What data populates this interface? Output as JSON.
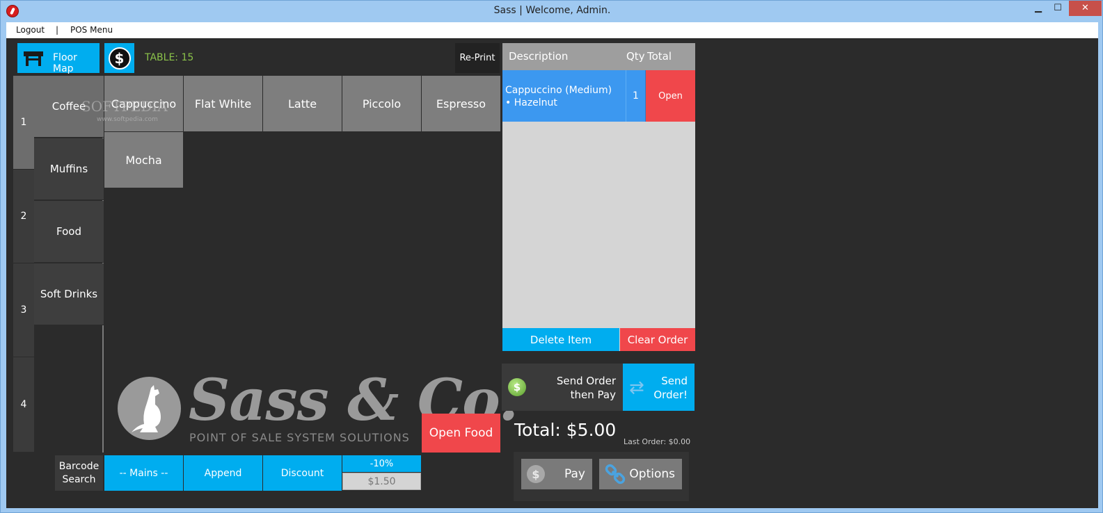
{
  "window": {
    "title": "Sass | Welcome, Admin.",
    "min_glyph": "▁",
    "max_glyph": "☐",
    "close_glyph": "✕"
  },
  "menu": {
    "logout": "Logout",
    "separator": "|",
    "pos_menu": "POS Menu"
  },
  "toolbar": {
    "floor_map": "Floor Map",
    "dollar_glyph": "$",
    "table_label": "TABLE: 15",
    "reprint": "Re-Print"
  },
  "pages": [
    "1",
    "2",
    "3",
    "4"
  ],
  "categories": [
    "Coffee",
    "Muffins",
    "Food",
    "Soft Drinks"
  ],
  "items": [
    "Cappuccino",
    "Flat White",
    "Latte",
    "Piccolo",
    "Espresso",
    "Mocha"
  ],
  "watermark": {
    "main": "SOFTPEDIA",
    "sub": "www.softpedia.com"
  },
  "logo": {
    "text": "Sass & Co.",
    "subtitle": "POINT OF SALE SYSTEM SOLUTIONS"
  },
  "open_food": "Open Food",
  "bottom": {
    "barcode_line1": "Barcode",
    "barcode_line2": "Search",
    "mains": "-- Mains --",
    "append": "Append",
    "discount": "Discount",
    "discount_pct": "-10%",
    "discount_amount": "$1.50"
  },
  "order": {
    "col_description": "Description",
    "col_qty": "Qty",
    "col_total": "Total",
    "rows": [
      {
        "description": "Cappuccino (Medium)",
        "modifier": " • Hazelnut",
        "qty": "1",
        "total": "Open"
      }
    ],
    "delete_item": "Delete Item",
    "clear_order": "Clear Order"
  },
  "send": {
    "send_pay_line1": "Send Order",
    "send_pay_line2": "then Pay",
    "send_order_line1": "Send",
    "send_order_line2": "Order!",
    "coin_glyph": "$",
    "sync_glyph": "⇄"
  },
  "totals": {
    "total": "Total: $5.00",
    "last_order": "Last Order: $0.00"
  },
  "actions": {
    "pay": "Pay",
    "options": "Options",
    "pay_glyph": "$"
  },
  "colors": {
    "accent_blue": "#00adef",
    "accent_red": "#f0474b",
    "table_green": "#8bc34a",
    "order_row_blue": "#3c98f0"
  }
}
